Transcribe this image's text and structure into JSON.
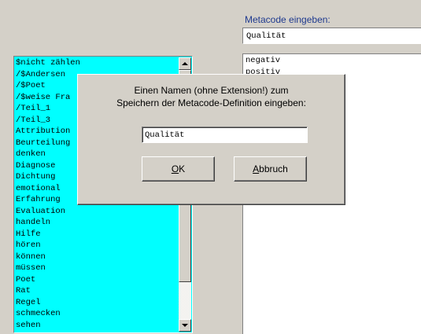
{
  "left_list": {
    "items": [
      "$nicht zählen",
      "/$Andersen",
      "/$Poet",
      "/$weise Fra",
      "/Teil_1",
      "/Teil_3",
      "Attribution",
      "Beurteilung",
      "denken",
      "Diagnose",
      "Dichtung",
      "emotional",
      "Erfahrung",
      "Evaluation",
      "handeln",
      "Hilfe",
      "hören",
      "können",
      "müssen",
      "Poet",
      "Rat",
      "Regel",
      "schmecken",
      "sehen"
    ]
  },
  "metacode": {
    "label": "Metacode eingeben:",
    "value": "Qualität"
  },
  "right_list": {
    "items": [
      "negativ",
      "positiv"
    ]
  },
  "dialog": {
    "message_line1": "Einen Namen (ohne Extension!) zum",
    "message_line2": "Speichern der Metacode-Definition eingeben:",
    "input_value": "Qualität",
    "ok_mnemonic": "O",
    "ok_rest": "K",
    "cancel_mnemonic": "A",
    "cancel_rest": "bbruch"
  }
}
